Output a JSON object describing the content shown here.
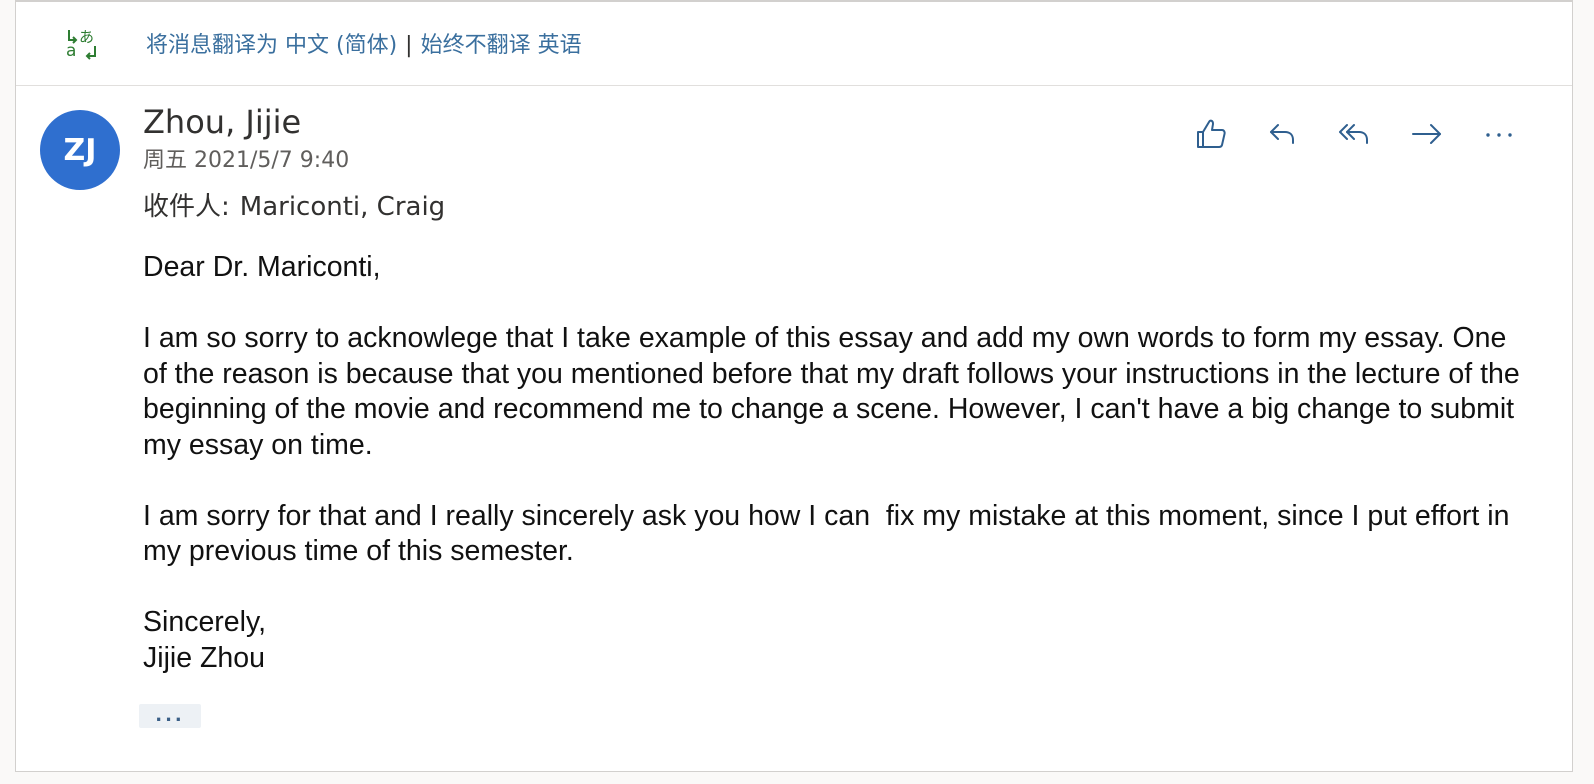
{
  "translation_bar": {
    "translate_link": "将消息翻译为 中文 (简体)",
    "separator": "|",
    "never_translate_link": "始终不翻译 英语"
  },
  "message": {
    "avatar_initials": "ZJ",
    "sender_name": "Zhou, Jijie",
    "date": "周五 2021/5/7 9:40",
    "to_label": "收件人:",
    "to_value": "Mariconti, Craig",
    "body_paragraphs": [
      "Dear Dr. Mariconti,",
      "I am so sorry to acknowlege that I take example of this essay and add my own words to form my essay. One of the reason is because that you mentioned before that my draft follows your instructions in the lecture of the beginning of the movie and recommend me to change a scene. However, I can't have a big change to submit my essay on time.",
      "I am sorry for that and I really sincerely ask you how I can  fix my mistake at this moment, since I put effort in my previous time of this semester.",
      "Sincerely,\nJijie Zhou"
    ],
    "expand_label": "..."
  },
  "actions": {
    "like_icon": "thumbs-up-icon",
    "reply_icon": "reply-icon",
    "reply_all_icon": "reply-all-icon",
    "forward_icon": "forward-icon",
    "more_label": "···"
  },
  "colors": {
    "avatar_bg": "#2f6fcf",
    "link": "#3a6f9e",
    "action_icon": "#2f5f8f",
    "translate_icon": "#2e7d32"
  }
}
